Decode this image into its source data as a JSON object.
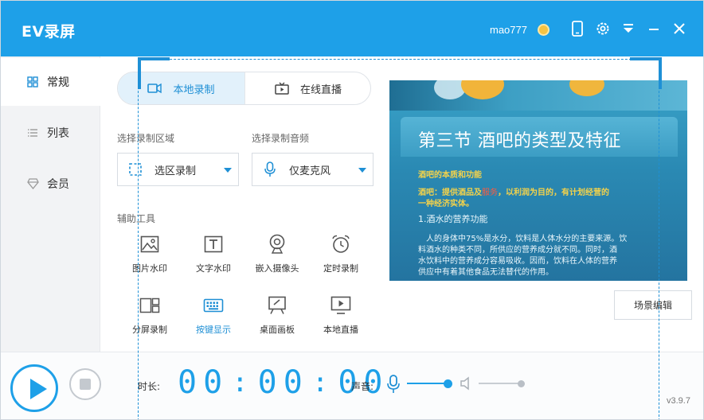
{
  "app": {
    "title": "EV录屏",
    "user": "mao777",
    "accent_color": "#1ea0e8",
    "titlebar_icons": [
      "phone-icon",
      "gear-icon",
      "dropdown-menu-icon",
      "minimize-icon",
      "close-icon"
    ]
  },
  "sidebar": {
    "items": [
      {
        "label": "常规",
        "icon": "grid-icon",
        "active": true
      },
      {
        "label": "列表",
        "icon": "list-icon",
        "active": false
      },
      {
        "label": "会员",
        "icon": "diamond-icon",
        "active": false
      }
    ]
  },
  "mode_tabs": [
    {
      "label": "本地录制",
      "icon": "video-icon",
      "active": true
    },
    {
      "label": "在线直播",
      "icon": "tv-icon",
      "active": false
    }
  ],
  "area": {
    "label": "选择录制区域",
    "value": "选区录制",
    "icon": "selection-icon"
  },
  "audio": {
    "label": "选择录制音频",
    "value": "仅麦克风",
    "icon": "microphone-icon"
  },
  "tools": {
    "label": "辅助工具",
    "items": [
      {
        "label": "图片水印",
        "icon": "image-icon"
      },
      {
        "label": "文字水印",
        "icon": "text-icon"
      },
      {
        "label": "嵌入摄像头",
        "icon": "webcam-icon"
      },
      {
        "label": "定时录制",
        "icon": "alarm-clock-icon"
      },
      {
        "label": "分屏录制",
        "icon": "split-screen-icon"
      },
      {
        "label": "按键显示",
        "icon": "keyboard-icon",
        "highlighted": true
      },
      {
        "label": "桌面画板",
        "icon": "easel-icon"
      },
      {
        "label": "本地直播",
        "icon": "monitor-play-icon"
      }
    ]
  },
  "preview": {
    "title": "第三节   酒吧的类型及特征",
    "line1": "酒吧的本质和功能",
    "line2_a": "酒吧：提供酒品及",
    "line2_b": "服务",
    "line2_c": "，以利润为目的，有计划经营的",
    "line3": "一种经济实体。",
    "line4": "1.酒水的营养功能",
    "body1": "人的身体中75%是水分，饮料是人体水分的主要来源。饮",
    "body2": "料酒水的种类不同，所供应的营养成分就不同。同时，酒",
    "body3": "水饮料中的营养成分容易吸收。因而，饮料在人体的营养",
    "body4": "供应中有着其他食品无法替代的作用。"
  },
  "scene_button": "场景编辑",
  "bottom": {
    "duration_label": "时长:",
    "time": {
      "h": "00",
      "m": "00",
      "s": "00"
    },
    "sound_label": "声音:",
    "mic_level": 1.0,
    "speaker_level": 1.0,
    "version": "v3.9.7"
  }
}
